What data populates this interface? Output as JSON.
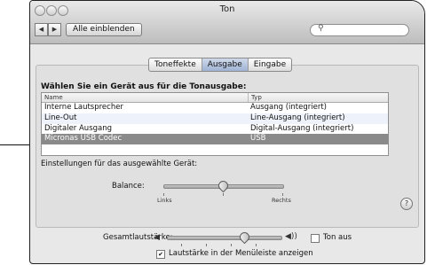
{
  "window": {
    "title": "Ton",
    "back_icon": "back-arrow-icon",
    "forward_icon": "forward-arrow-icon",
    "show_all_label": "Alle einblenden",
    "search_icon": "magnifier-icon"
  },
  "tabs": [
    {
      "label": "Toneffekte",
      "active": false
    },
    {
      "label": "Ausgabe",
      "active": true
    },
    {
      "label": "Eingabe",
      "active": false
    }
  ],
  "output": {
    "heading": "Wählen Sie ein Gerät aus für die Tonausgabe:",
    "columns": [
      "Name",
      "Typ"
    ],
    "rows": [
      {
        "name": "Interne Lautsprecher",
        "type": "Ausgang (integriert)"
      },
      {
        "name": "Line-Out",
        "type": "Line-Ausgang (integriert)"
      },
      {
        "name": "Digitaler Ausgang",
        "type": "Digital-Ausgang (integriert)"
      },
      {
        "name": "Micronas USB Codec",
        "type": "USB",
        "selected": true
      }
    ],
    "settings_label": "Einstellungen für das ausgewählte Gerät:",
    "balance_label": "Balance:",
    "balance_left": "Links",
    "balance_right": "Rechts",
    "balance_value": 0.5,
    "help_label": "?"
  },
  "volume": {
    "label": "Gesamtlautstärke:",
    "value": 0.68,
    "mute_label": "Ton aus",
    "mute_checked": false,
    "menubar_label": "Lautstärke in der Menüleiste anzeigen",
    "menubar_checked": true
  }
}
